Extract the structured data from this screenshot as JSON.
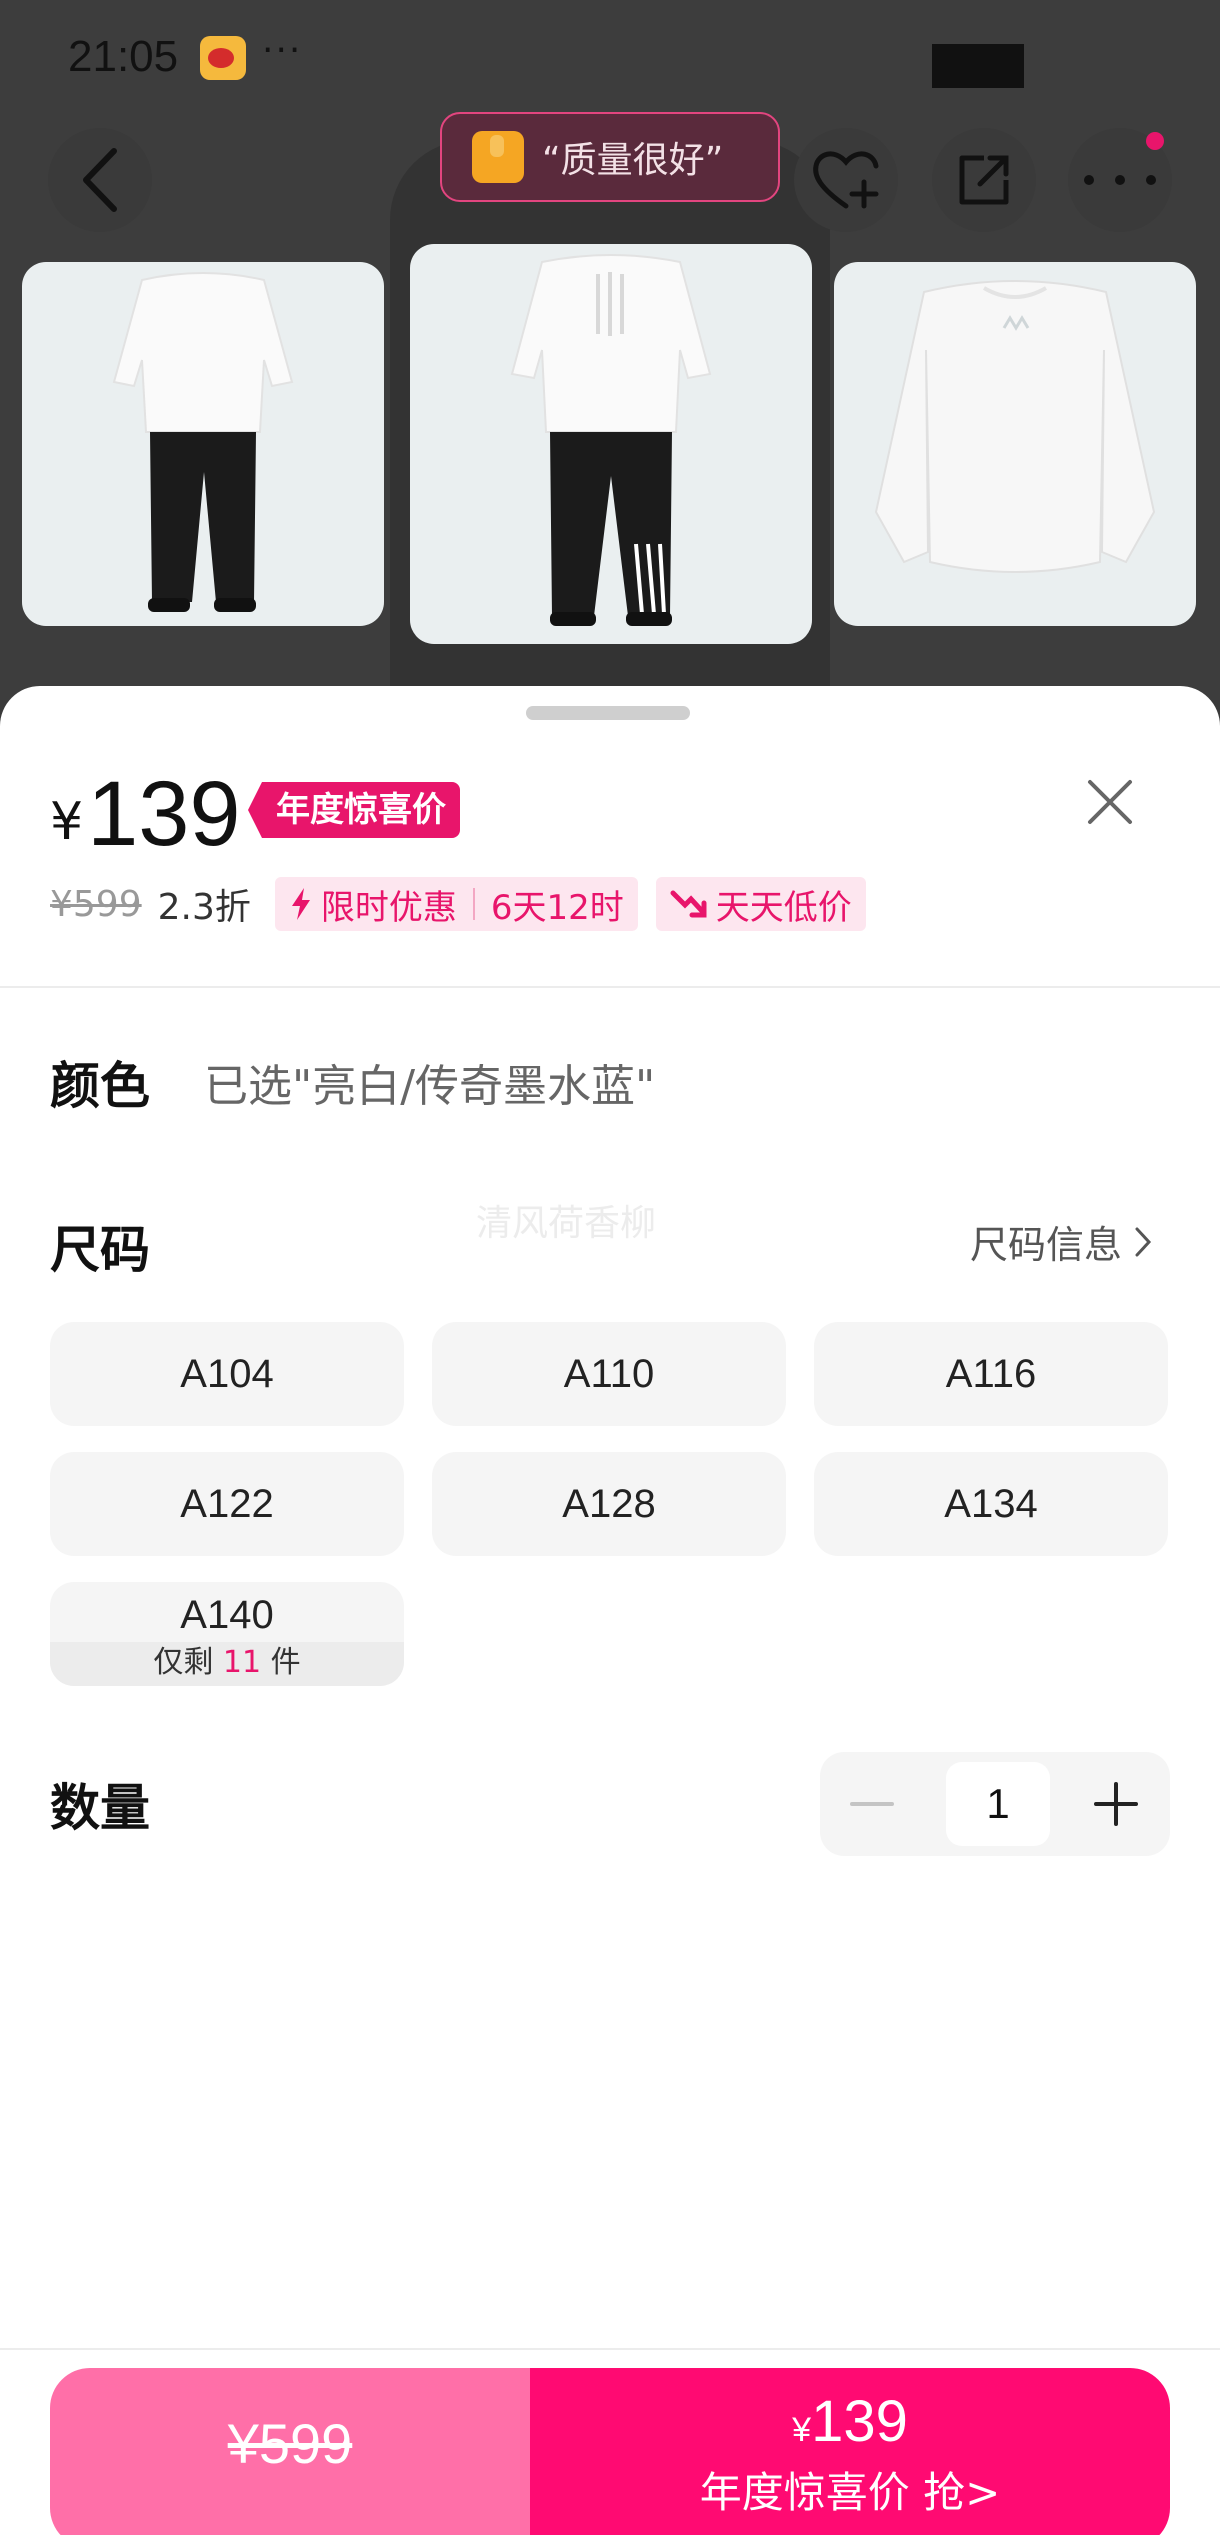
{
  "status_bar": {
    "time": "21:05",
    "dots": "···"
  },
  "quality_badge": {
    "text": "“质量很好”"
  },
  "header_icons": [
    "back-icon",
    "favorite-add-icon",
    "share-icon",
    "more-icon"
  ],
  "price": {
    "currency": "¥",
    "amount": "139",
    "promo_badge": "年度惊喜价",
    "original_price": "¥599",
    "discount": "2.3折",
    "tag_limited": "限时优惠",
    "tag_countdown": "6天12时",
    "tag_low": "天天低价"
  },
  "color": {
    "label": "颜色",
    "selected": "已选\"亮白/传奇墨水蓝\""
  },
  "watermark": "清风荷香柳",
  "size": {
    "label": "尺码",
    "info_link": "尺码信息",
    "options": [
      "A104",
      "A110",
      "A116",
      "A122",
      "A128",
      "A134",
      "A140"
    ],
    "low_stock_prefix": "仅剩",
    "low_stock_count": "11",
    "low_stock_suffix": "件"
  },
  "quantity": {
    "label": "数量",
    "value": "1"
  },
  "bottom_bar": {
    "original_price": "¥599",
    "currency": "¥",
    "price": "139",
    "cta": "年度惊喜价 抢>"
  },
  "colors": {
    "accent": "#ff0a72",
    "accent_light": "#ff6fa8",
    "tag_bg": "#fde6ef"
  }
}
